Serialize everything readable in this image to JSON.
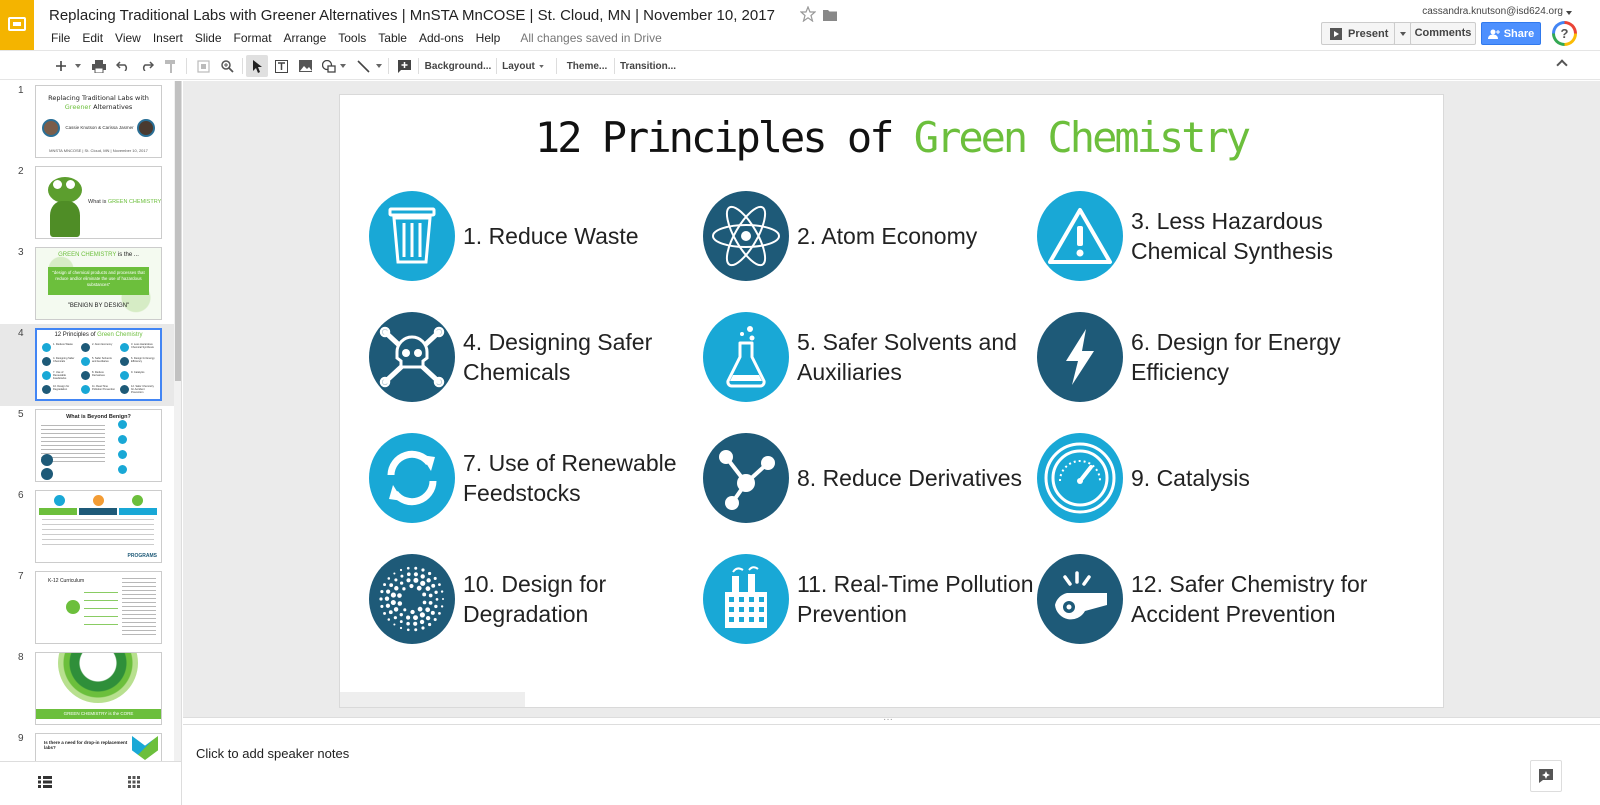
{
  "header": {
    "title": "Replacing Traditional Labs with Greener Alternatives | MnSTA MnCOSE | St. Cloud, MN | November 10, 2017",
    "menu": [
      "File",
      "Edit",
      "View",
      "Insert",
      "Slide",
      "Format",
      "Arrange",
      "Tools",
      "Table",
      "Add-ons",
      "Help"
    ],
    "save_status": "All changes saved in Drive",
    "account": "cassandra.knutson@isd624.org",
    "present_label": "Present",
    "comments_label": "Comments",
    "share_label": "Share",
    "help_label": "?"
  },
  "toolbar": {
    "background_label": "Background...",
    "layout_label": "Layout",
    "theme_label": "Theme...",
    "transition_label": "Transition..."
  },
  "filmstrip": {
    "slides": [
      {
        "num": "1",
        "title_a": "Replacing Traditional Labs with",
        "title_green": "Greener",
        "title_b": " Alternatives",
        "sub": "Cassie Knutson & Carissa Jasmer",
        "footer": "MNSTA MNCOSE | St. Cloud, MN | November 10, 2017"
      },
      {
        "num": "2",
        "text_a": "What is ",
        "text_green": "GREEN CHEMISTRY",
        "text_b": "?"
      },
      {
        "num": "3",
        "head_green": "GREEN CHEMISTRY",
        "head_b": " is the ...",
        "quote": "\"design of chemical products and processes that reduce and/or eliminate the use of hazardous substances\"",
        "tag": "\"BENIGN BY DESIGN\""
      },
      {
        "num": "4",
        "title_a": "12 Principles of ",
        "title_green": "Green Chemistry"
      },
      {
        "num": "5",
        "title": "What is Beyond Benign?"
      },
      {
        "num": "6",
        "footer": "PROGRAMS"
      },
      {
        "num": "7",
        "title": "K-12 Curriculum"
      },
      {
        "num": "8",
        "banner_a": "GREEN CHEMISTRY",
        "banner_b": " is the CORE"
      },
      {
        "num": "9",
        "title": "Is there a need for drop-in replacement labs?"
      }
    ]
  },
  "slide": {
    "title_a": "12 Principles of ",
    "title_green": "Green Chemistry",
    "principles": [
      {
        "label": "1. Reduce Waste",
        "icon": "trash-can-icon",
        "tone": "light"
      },
      {
        "label": "2. Atom Economy",
        "icon": "atom-icon",
        "tone": "dark"
      },
      {
        "label": "3. Less Hazardous Chemical Synthesis",
        "icon": "warning-icon",
        "tone": "light"
      },
      {
        "label": "4. Designing Safer Chemicals",
        "icon": "skull-crossbones-icon",
        "tone": "dark"
      },
      {
        "label": "5. Safer Solvents and Auxiliaries",
        "icon": "flask-icon",
        "tone": "light"
      },
      {
        "label": "6. Design for Energy Efficiency",
        "icon": "lightning-icon",
        "tone": "dark"
      },
      {
        "label": "7. Use of Renewable Feedstocks",
        "icon": "recycle-arrows-icon",
        "tone": "light"
      },
      {
        "label": "8. Reduce Derivatives",
        "icon": "molecule-icon",
        "tone": "dark"
      },
      {
        "label": "9. Catalysis",
        "icon": "gauge-icon",
        "tone": "light"
      },
      {
        "label": "10. Design for Degradation",
        "icon": "dissolving-dots-icon",
        "tone": "dark"
      },
      {
        "label": "11. Real-Time Pollution Prevention",
        "icon": "factory-icon",
        "tone": "light"
      },
      {
        "label": "12. Safer Chemistry for Accident Prevention",
        "icon": "whistle-icon",
        "tone": "dark"
      }
    ]
  },
  "notes": {
    "placeholder": "Click to add speaker notes"
  },
  "colors": {
    "accent_green": "#6cbf3c",
    "icon_light": "#19a8d6",
    "icon_dark": "#1e5a78",
    "app_yellow": "#f4b400",
    "share_blue": "#4d90fe"
  }
}
